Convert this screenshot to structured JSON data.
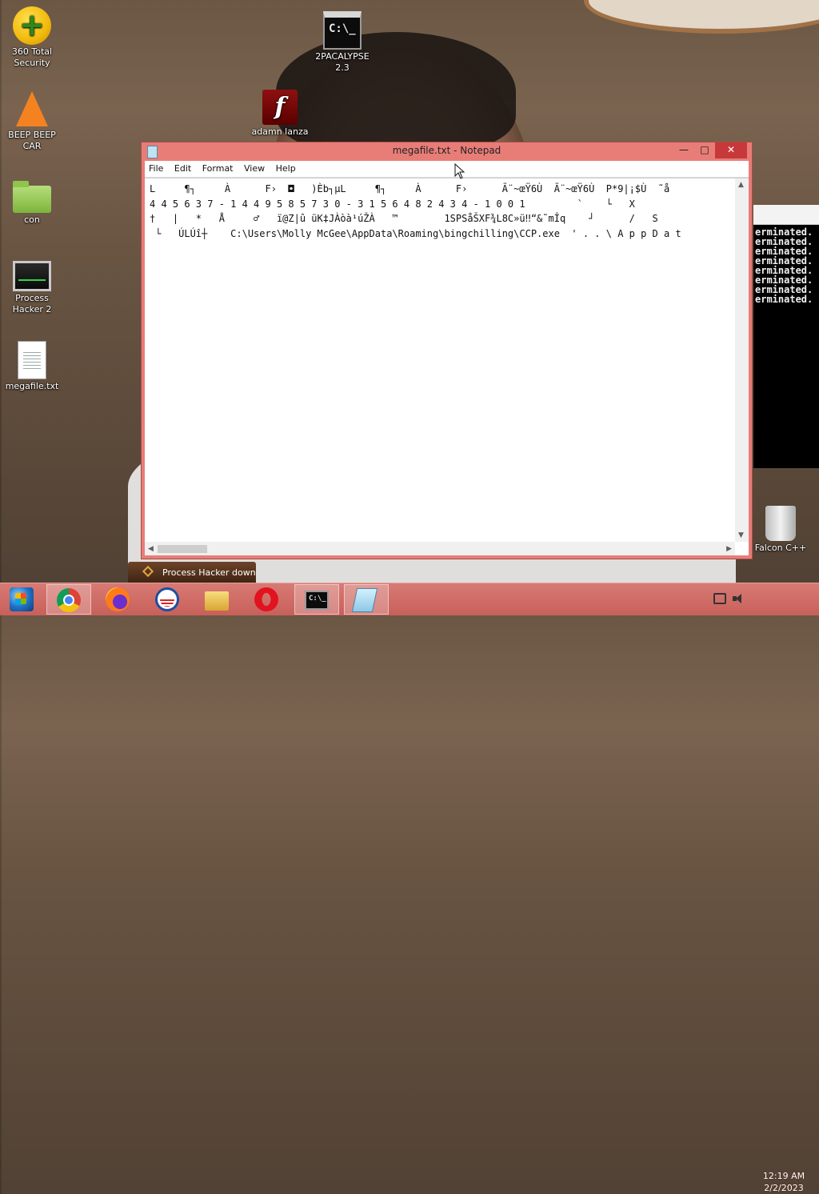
{
  "desktop": {
    "icons": [
      {
        "label": "360 Total Security",
        "icon": "360-total-security-icon"
      },
      {
        "label": "2PACALYPSE 2.3",
        "icon": "command-prompt-icon"
      },
      {
        "label": "adamn lanza",
        "icon": "flash-player-icon"
      },
      {
        "label": "BEEP BEEP CAR",
        "icon": "vlc-cone-icon"
      },
      {
        "label": "con",
        "icon": "folder-icon"
      },
      {
        "label": "Process Hacker 2",
        "icon": "process-hacker-icon"
      },
      {
        "label": "megafile.txt",
        "icon": "text-file-icon"
      },
      {
        "label": "Falcon C++",
        "icon": "recycle-bin-icon"
      }
    ]
  },
  "notepad": {
    "title": "megafile.txt - Notepad",
    "menu": [
      "File",
      "Edit",
      "Format",
      "View",
      "Help"
    ],
    "lines": [
      "L     ¶┐     À      F›  ◘   )Èb┐µL     ¶┐     À      F›      Ã¨~œŸ6Ù  Ã¨~œŸ6Ù  P*9|¡$Ù  ˜å",
      "4 4 5 6 3 7 - 1 4 4 9 5 8 5 7 3 0 - 3 1 5 6 4 8 2 4 3 4 - 1 0 0 1         `    └   X",
      "†   |   *   Å     ♂   ï@Z|û üK‡JÀòà¹úŽÀ   ™        1SPSåŠXF¾L8C»ü‼“&˜mÎq    ┘      /   S",
      " └   ÚLÚî┼    C:\\Users\\Molly McGee\\AppData\\Roaming\\bingchilling\\CCP.exe  ' . . \\ A p p D a t"
    ]
  },
  "console": {
    "lines": [
      "erminated.",
      "erminated.",
      "erminated.",
      "erminated.",
      "erminated.",
      "erminated.",
      "erminated.",
      "erminated."
    ]
  },
  "toast": {
    "label": "Process Hacker downlo"
  },
  "taskbar": {
    "apps": [
      "Start",
      "Google Chrome",
      "Firefox",
      "Obama",
      "File Explorer",
      "Opera",
      "Command Prompt",
      "Notepad"
    ],
    "clock_time": "12:19 AM",
    "clock_date": "2/2/2023"
  },
  "colors": {
    "accent": "#d87a74",
    "close": "#c7383a"
  }
}
